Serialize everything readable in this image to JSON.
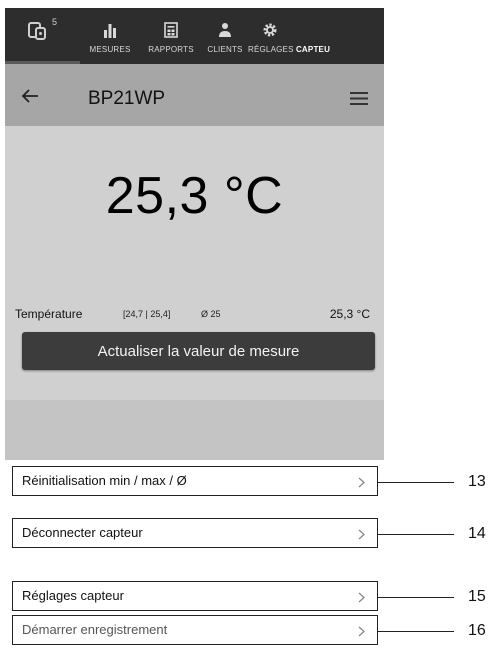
{
  "nav": {
    "badge": "5",
    "tabs": [
      {
        "label": "MESURES",
        "icon": "bar-chart-icon"
      },
      {
        "label": "RAPPORTS",
        "icon": "report-icon"
      },
      {
        "label": "CLIENTS",
        "icon": "clients-icon"
      },
      {
        "label": "RÉGLAGES",
        "icon": "gear-icon"
      },
      {
        "label": "CAPTEU",
        "icon": "sensor-icon"
      }
    ]
  },
  "appbar": {
    "device_name": "BP21WP"
  },
  "reading": {
    "big_value": "25,3 °C",
    "label": "Température",
    "range": "[24,7 | 25,4]",
    "avg": "Ø 25",
    "value": "25,3 °C",
    "refresh_button": "Actualiser la valeur de mesure"
  },
  "menu": [
    {
      "label": "Réinitialisation min / max / Ø",
      "callout": "13"
    },
    {
      "label": "Déconnecter capteur",
      "callout": "14"
    },
    {
      "label": "Réglages capteur",
      "callout": "15"
    },
    {
      "label": "Démarrer enregistrement",
      "callout": "16"
    }
  ],
  "colors": {
    "nav_bg": "#2d2d2d",
    "appbar_bg": "#a6a6a6",
    "content_bg": "#d0d0d0",
    "button_bg": "#3c3c3c"
  }
}
